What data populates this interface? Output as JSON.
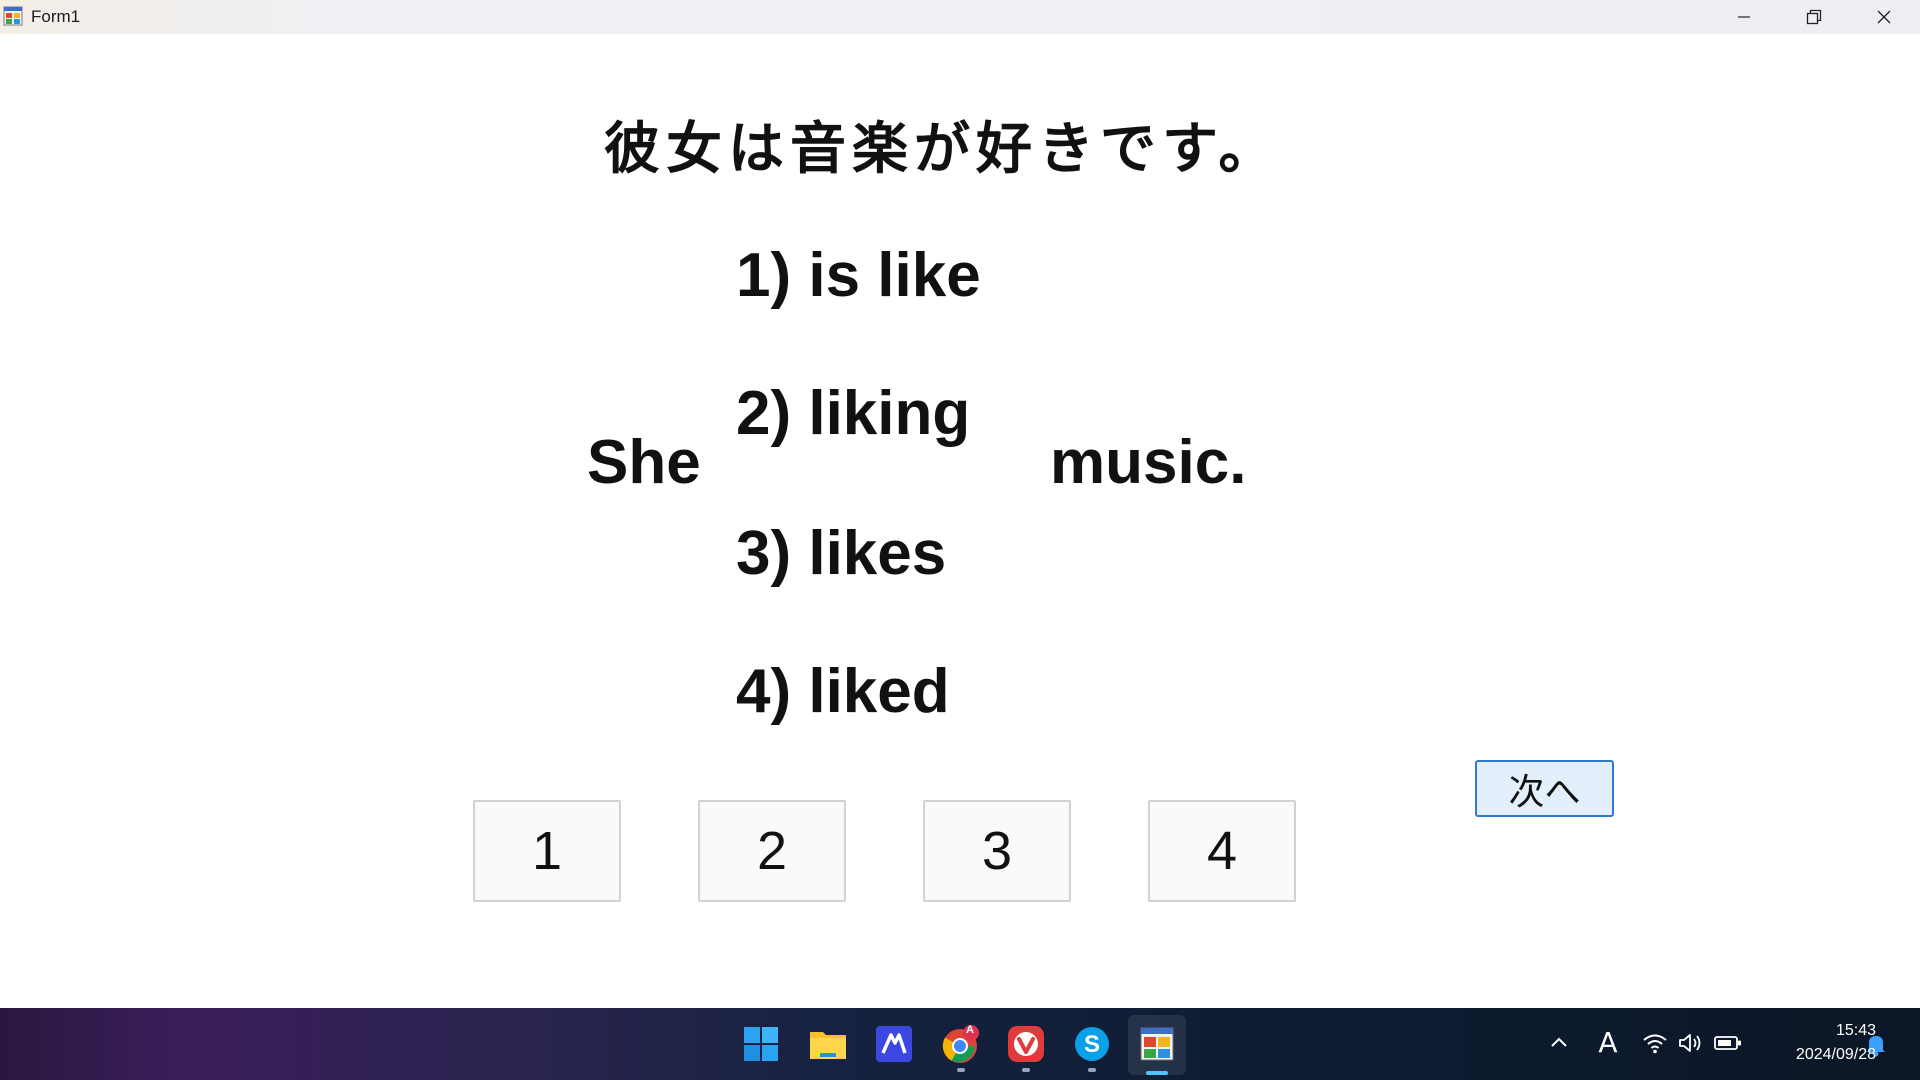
{
  "window": {
    "title": "Form1"
  },
  "question": {
    "japanese": "彼女は音楽が好きです。",
    "subject": "She",
    "object": "music.",
    "options": [
      "1) is like",
      "2) liking",
      "3) likes",
      "4) liked"
    ]
  },
  "answer_buttons": [
    "1",
    "2",
    "3",
    "4"
  ],
  "next_button": "次へ",
  "taskbar": {
    "apps": [
      "start-icon",
      "file-explorer-icon",
      "app-icon",
      "chrome-icon",
      "vivaldi-icon",
      "skype-icon",
      "form1-app-icon"
    ],
    "chrome_badge": "A",
    "ime_indicator": "A",
    "clock": {
      "time": "15:43",
      "date": "2024/09/28"
    }
  },
  "colors": {
    "next_button_border": "#2e7bd0",
    "next_button_bg": "#e3f0fb",
    "active_indicator": "#4cc2ff"
  }
}
